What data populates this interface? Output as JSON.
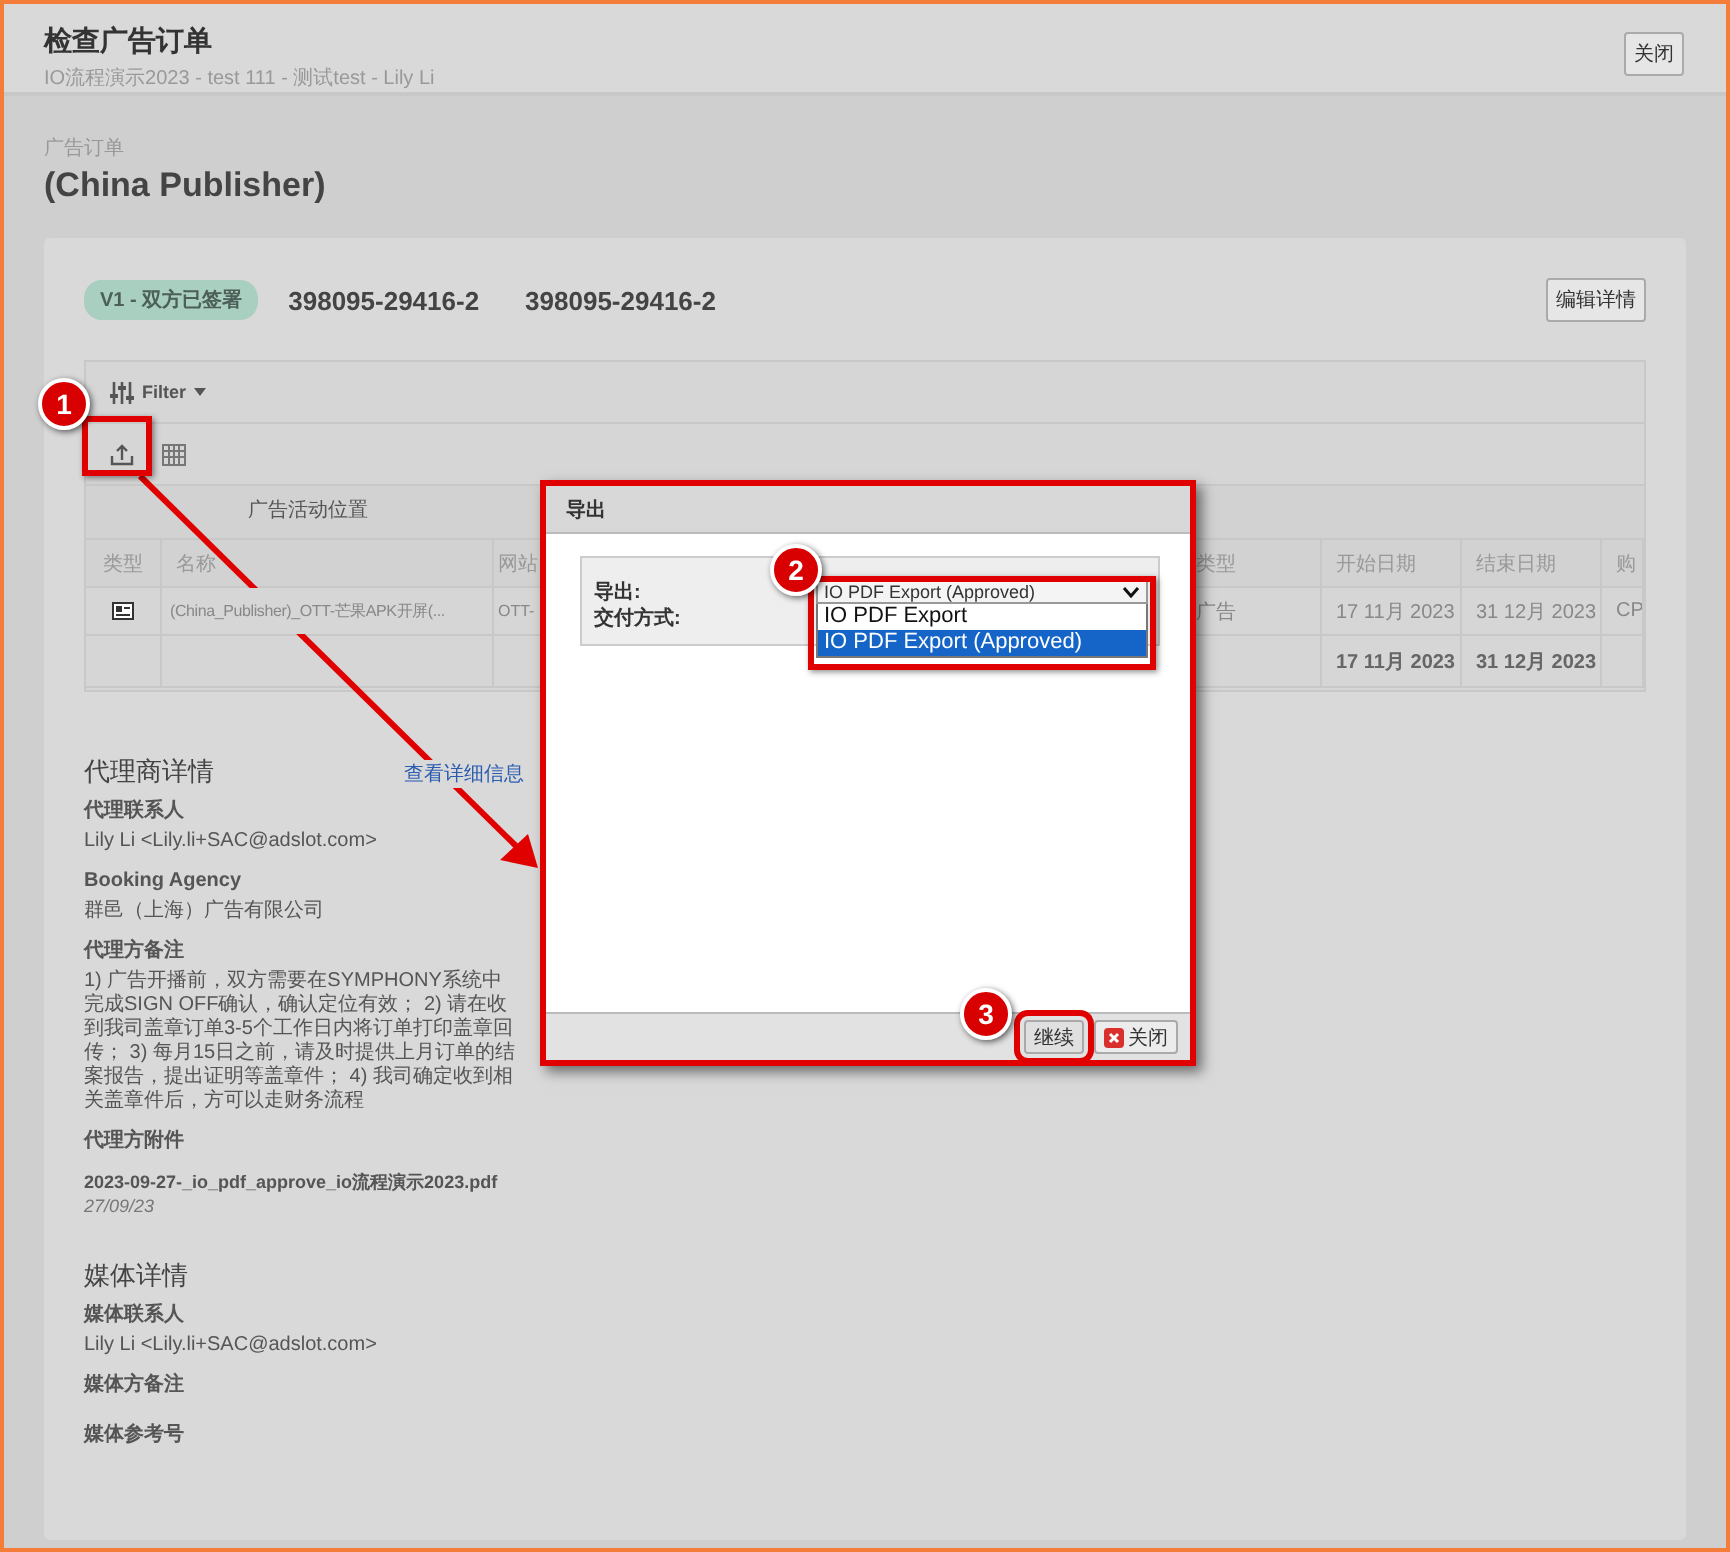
{
  "header": {
    "title": "检查广告订单",
    "subtitle": "IO流程演示2023 - test 111 - 测试test - Lily Li",
    "close_button": "关闭"
  },
  "order": {
    "label": "广告订单",
    "name": "(China Publisher)"
  },
  "card": {
    "status_badge": "V1 - 双方已签署",
    "numbers": [
      "398095-29416-2",
      "398095-29416-2"
    ],
    "edit_button": "编辑详情"
  },
  "table": {
    "filter": "Filter",
    "group_header": "广告活动位置",
    "columns": [
      {
        "label": "类型"
      },
      {
        "label": "名称"
      },
      {
        "label": "网站"
      },
      {
        "label": "类型"
      },
      {
        "label": "开始日期"
      },
      {
        "label": "结束日期"
      },
      {
        "label": "购"
      }
    ],
    "rows": [
      {
        "name": "(China_Publisher)_OTT-芒果APK开屏(...",
        "site": "OTT-",
        "type": "广告",
        "start": "17 11月 2023",
        "end": "31 12月 2023",
        "buy": "CP"
      }
    ],
    "totals": {
      "start": "17 11月 2023",
      "end": "31 12月 2023"
    }
  },
  "agency": {
    "heading": "代理商详情",
    "link": "查看详细信息",
    "fields": [
      {
        "label": "代理联系人",
        "value": "Lily Li <Lily.li+SAC@adslot.com>"
      },
      {
        "label": "Booking Agency",
        "value": "群邑（上海）广告有限公司"
      },
      {
        "label": "代理方备注",
        "value": "1) 广告开播前，双方需要在SYMPHONY系统中完成SIGN OFF确认，确认定位有效； 2) 请在收到我司盖章订单3-5个工作日内将订单打印盖章回传； 3) 每月15日之前，请及时提供上月订单的结案报告，提出证明等盖章件； 4) 我司确定收到相关盖章件后，方可以走财务流程"
      }
    ],
    "attachments": {
      "label": "代理方附件",
      "file": "2023-09-27-_io_pdf_approve_io流程演示2023.pdf",
      "date": "27/09/23"
    }
  },
  "media": {
    "heading": "媒体详情",
    "fields": [
      {
        "label": "媒体联系人",
        "value": "Lily Li <Lily.li+SAC@adslot.com>"
      },
      {
        "label": "媒体方备注"
      },
      {
        "label": "媒体参考号"
      }
    ]
  },
  "dialog": {
    "title": "导出",
    "fields": [
      {
        "label": "导出:"
      },
      {
        "label": "交付方式:"
      }
    ],
    "select": {
      "value": "IO PDF Export (Approved)",
      "expanded": true,
      "options": [
        {
          "label": "IO PDF Export",
          "selected": false
        },
        {
          "label": "IO PDF Export (Approved)",
          "selected": true
        }
      ]
    },
    "buttons": [
      {
        "label": "继续",
        "kind": "primary"
      },
      {
        "label": "关闭",
        "kind": "close"
      }
    ]
  },
  "callouts": [
    {
      "number": "1"
    },
    {
      "number": "2"
    },
    {
      "number": "3"
    }
  ]
}
